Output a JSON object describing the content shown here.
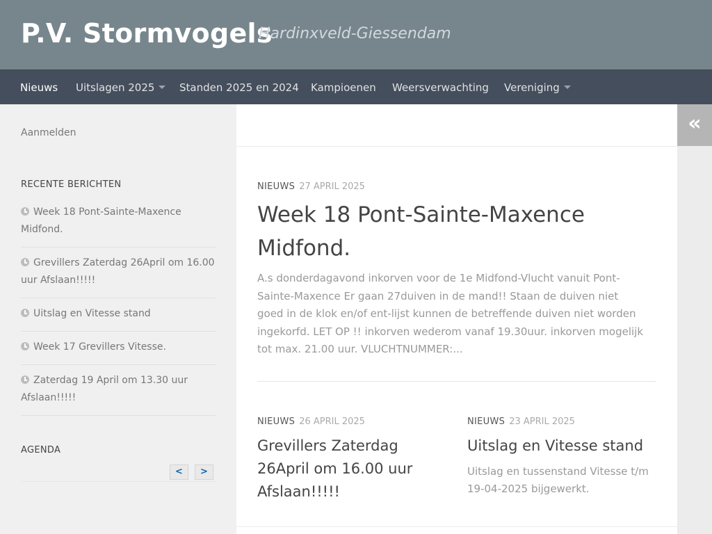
{
  "header": {
    "title": "P.V. Stormvogels",
    "tagline": "Hardinxveld-Giessendam"
  },
  "nav": {
    "items": [
      {
        "label": "Nieuws",
        "active": true
      },
      {
        "label": "Uitslagen 2025",
        "has_dropdown": true
      },
      {
        "label": "Standen 2025 en 2024"
      },
      {
        "label": "Kampioenen"
      },
      {
        "label": "Weersverwachting"
      },
      {
        "label": "Vereniging",
        "has_dropdown": true
      }
    ]
  },
  "sidebar": {
    "login_label": "Aanmelden",
    "recent_title": "RECENTE BERICHTEN",
    "recent_posts": [
      "Week 18 Pont-Sainte-Maxence Midfond.",
      "Grevillers Zaterdag 26April om 16.00 uur Afslaan!!!!!",
      "Uitslag en Vitesse stand",
      "Week 17 Grevillers Vitesse.",
      "Zaterdag 19 April om 13.30 uur Afslaan!!!!!"
    ],
    "agenda_title": "AGENDA",
    "agenda_prev": "<",
    "agenda_next": ">"
  },
  "collapse_icon": "«",
  "featured": {
    "category": "NIEUWS",
    "date": "27 APRIL 2025",
    "title": "Week 18 Pont-Sainte-Maxence Midfond.",
    "excerpt": "A.s donderdagavond inkorven voor de 1e Midfond-Vlucht vanuit Pont-Sainte-Maxence Er gaan 27duiven in de mand!! Staan de duiven niet goed in de klok en/of ent-lijst kunnen de betreffende duiven niet worden ingekorfd. LET OP !! inkorven wederom vanaf 19.30uur. inkorven mogelijk tot max. 21.00 uur. VLUCHTNUMMER:..."
  },
  "posts": [
    {
      "category": "NIEUWS",
      "date": "26 APRIL 2025",
      "title": "Grevillers Zaterdag 26April om 16.00 uur Afslaan!!!!!",
      "excerpt": ""
    },
    {
      "category": "NIEUWS",
      "date": "23 APRIL 2025",
      "title": "Uitslag en Vitesse stand",
      "excerpt": "Uitslag en tussenstand Vitesse t/m 19-04-2025 bijgewerkt."
    }
  ],
  "colors": {
    "header_bg": "#77868d",
    "nav_bg": "#454e5c",
    "sidebar_bg": "#f0f0f0",
    "agenda_arrow": "#1166aa"
  }
}
